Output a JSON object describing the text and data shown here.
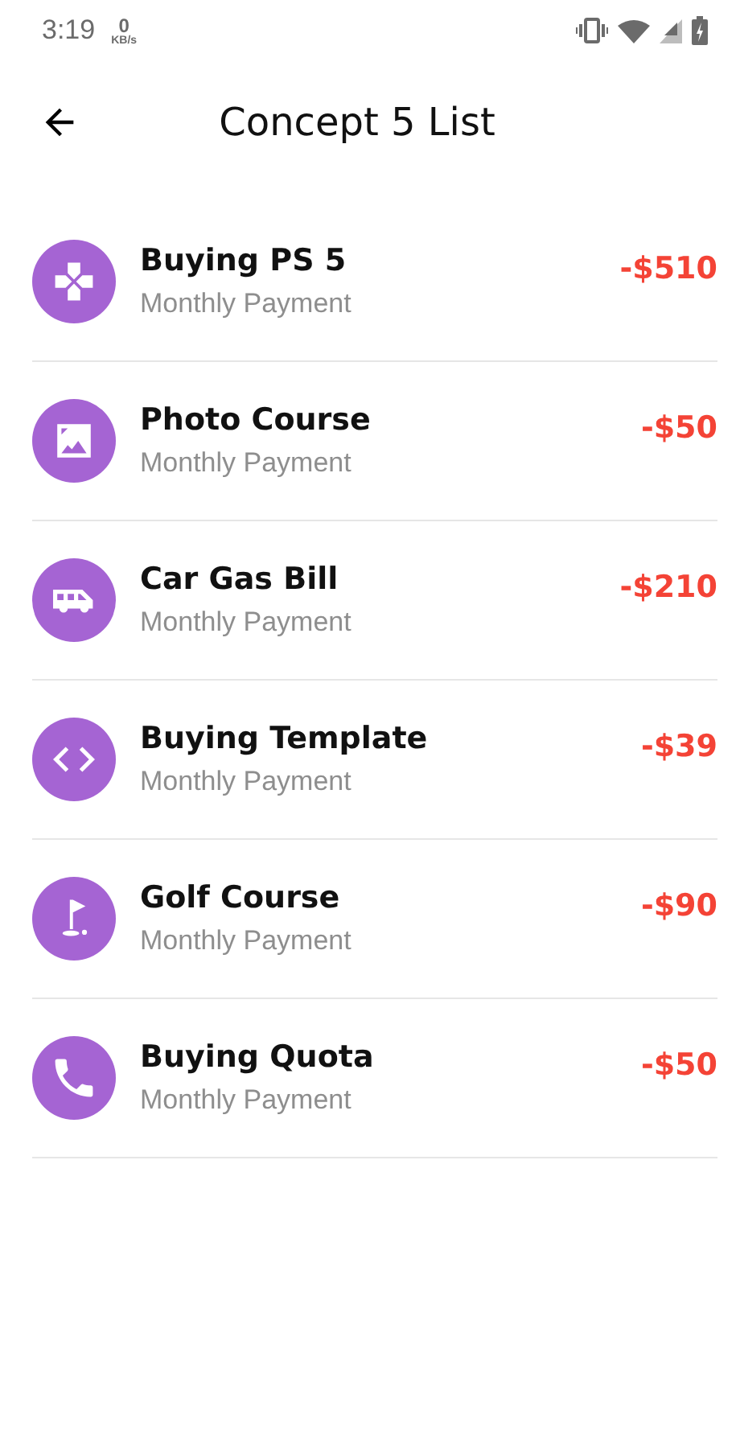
{
  "status_bar": {
    "time": "3:19",
    "speed_value": "0",
    "speed_unit": "KB/s"
  },
  "header": {
    "title": "Concept 5 List"
  },
  "items": [
    {
      "kind": "gamepad",
      "title": "Buying PS 5",
      "subtitle": "Monthly Payment",
      "amount": "-$510"
    },
    {
      "kind": "image",
      "title": "Photo Course",
      "subtitle": "Monthly Payment",
      "amount": "-$50"
    },
    {
      "kind": "van",
      "title": "Car Gas Bill",
      "subtitle": "Monthly Payment",
      "amount": "-$210"
    },
    {
      "kind": "code",
      "title": "Buying Template",
      "subtitle": "Monthly Payment",
      "amount": "-$39"
    },
    {
      "kind": "golf",
      "title": "Golf Course",
      "subtitle": "Monthly Payment",
      "amount": "-$90"
    },
    {
      "kind": "phone",
      "title": "Buying Quota",
      "subtitle": "Monthly Payment",
      "amount": "-$50"
    }
  ]
}
